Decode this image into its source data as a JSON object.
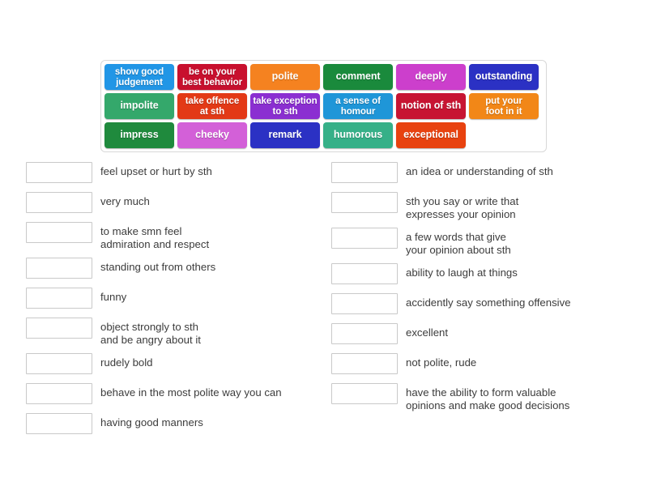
{
  "word_bank": {
    "rows": [
      [
        {
          "label": "show good\njudgement",
          "color": "#2196e6",
          "two_line": true
        },
        {
          "label": "be on your\nbest behavior",
          "color": "#c8102e",
          "two_line": true
        },
        {
          "label": "polite",
          "color": "#f58220",
          "two_line": false
        },
        {
          "label": "comment",
          "color": "#1a8a3c",
          "two_line": false
        },
        {
          "label": "deeply",
          "color": "#cc3fcc",
          "two_line": false
        },
        {
          "label": "outstanding",
          "color": "#2b31c4",
          "two_line": false
        }
      ],
      [
        {
          "label": "impolite",
          "color": "#34a86b",
          "two_line": false
        },
        {
          "label": "take offence\nat sth",
          "color": "#e33916",
          "two_line": true
        },
        {
          "label": "take exception\nto sth",
          "color": "#8b2fd1",
          "two_line": true
        },
        {
          "label": "a sense of\nhomour",
          "color": "#1f96d8",
          "two_line": true
        },
        {
          "label": "notion of sth",
          "color": "#c71432",
          "two_line": false
        },
        {
          "label": "put your\nfoot in it",
          "color": "#f28717",
          "two_line": true
        }
      ],
      [
        {
          "label": "impress",
          "color": "#1f8a3d",
          "two_line": false
        },
        {
          "label": "cheeky",
          "color": "#d360d8",
          "two_line": false
        },
        {
          "label": "remark",
          "color": "#2b31c4",
          "two_line": false
        },
        {
          "label": "humorous",
          "color": "#36b088",
          "two_line": false
        },
        {
          "label": "exceptional",
          "color": "#e8420f",
          "two_line": false
        },
        {
          "label": "",
          "color": "transparent",
          "two_line": false
        }
      ]
    ]
  },
  "left_column": [
    {
      "answer": "",
      "definition": "feel upset or hurt by sth"
    },
    {
      "answer": "",
      "definition": "very much"
    },
    {
      "answer": "",
      "definition": "to make smn feel\nadmiration and respect"
    },
    {
      "answer": "",
      "definition": "standing out from others"
    },
    {
      "answer": "",
      "definition": "funny"
    },
    {
      "answer": "",
      "definition": "object strongly to sth\nand be angry about it"
    },
    {
      "answer": "",
      "definition": "rudely bold"
    },
    {
      "answer": "",
      "definition": "behave in the most polite way you can"
    },
    {
      "answer": "",
      "definition": "having good manners"
    }
  ],
  "right_column": [
    {
      "answer": "",
      "definition": "an idea or understanding of sth"
    },
    {
      "answer": "",
      "definition": "sth you say or write that\nexpresses your opinion"
    },
    {
      "answer": "",
      "definition": "a few words that give\nyour opinion about sth"
    },
    {
      "answer": "",
      "definition": "ability to laugh at things"
    },
    {
      "answer": "",
      "definition": "accidently say something offensive"
    },
    {
      "answer": "",
      "definition": "excellent"
    },
    {
      "answer": "",
      "definition": "not polite, rude"
    },
    {
      "answer": "",
      "definition": "have the ability to form valuable\nopinions and make good decisions"
    }
  ]
}
